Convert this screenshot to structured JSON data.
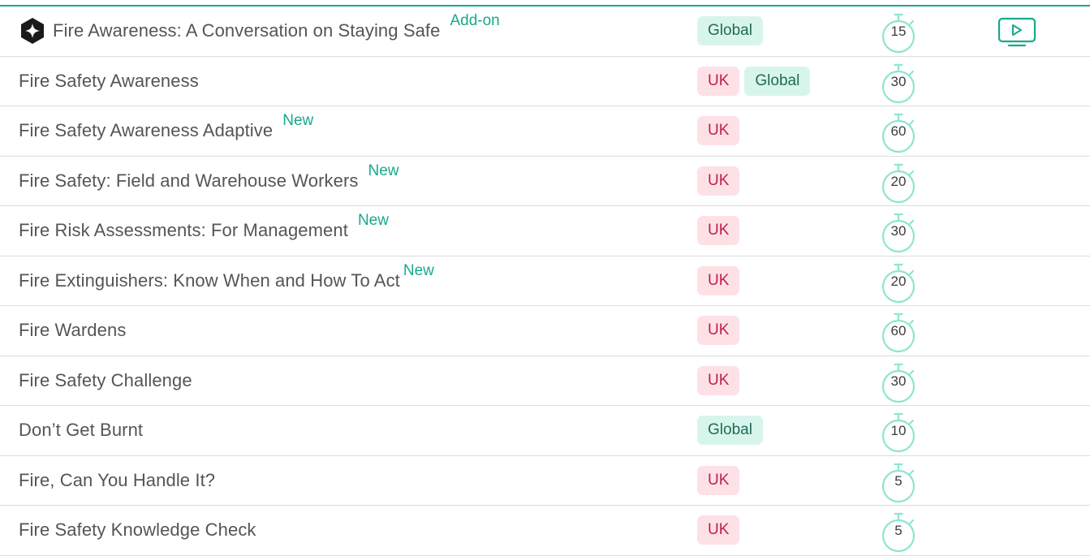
{
  "table": {
    "rows": [
      {
        "title": "Fire Awareness: A Conversation on Staying Safe",
        "flag": "Add-on",
        "regions": [
          "Global"
        ],
        "duration": "15",
        "brand_icon": "brand-logo-icon",
        "media_icon": "video-play-icon"
      },
      {
        "title": "Fire Safety Awareness",
        "flag": "",
        "regions": [
          "UK",
          "Global"
        ],
        "duration": "30"
      },
      {
        "title": "Fire Safety Awareness Adaptive",
        "flag": "New",
        "regions": [
          "UK"
        ],
        "duration": "60"
      },
      {
        "title": "Fire Safety: Field and Warehouse Workers",
        "flag": "New",
        "regions": [
          "UK"
        ],
        "duration": "20"
      },
      {
        "title": "Fire Risk Assessments: For Management",
        "flag": "New",
        "regions": [
          "UK"
        ],
        "duration": "30"
      },
      {
        "title": "Fire Extinguishers: Know When and How To Act",
        "flag": "New",
        "regions": [
          "UK"
        ],
        "duration": "20"
      },
      {
        "title": "Fire Wardens",
        "flag": "",
        "regions": [
          "UK"
        ],
        "duration": "60"
      },
      {
        "title": "Fire Safety Challenge",
        "flag": "",
        "regions": [
          "UK"
        ],
        "duration": "30"
      },
      {
        "title": "Don’t Get Burnt",
        "flag": "",
        "regions": [
          "Global"
        ],
        "duration": "10"
      },
      {
        "title": "Fire, Can You Handle It?",
        "flag": "",
        "regions": [
          "UK"
        ],
        "duration": "5"
      },
      {
        "title": "Fire Safety Knowledge Check",
        "flag": "",
        "regions": [
          "UK"
        ],
        "duration": "5"
      }
    ]
  },
  "colors": {
    "accent": "#17a98c",
    "uk_tag_bg": "#fde1e6",
    "uk_tag_text": "#c01f4a",
    "global_tag_bg": "#d8f5ec",
    "global_tag_text": "#1f6a57",
    "timer_stroke": "#8ee6cf"
  }
}
